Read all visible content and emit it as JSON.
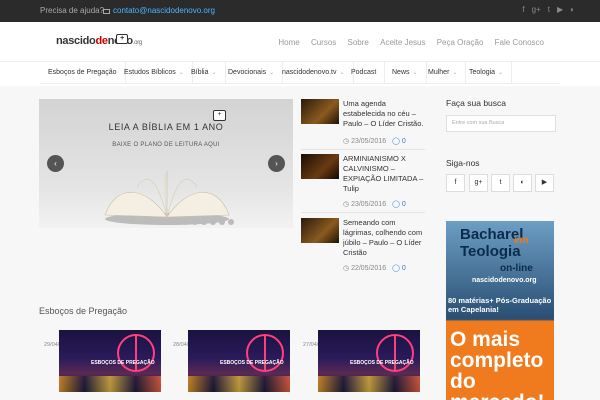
{
  "topbar": {
    "help": "Precisa de ajuda?",
    "email": "contato@nascidodenovo.org",
    "social_icons": [
      "facebook-icon",
      "google-plus-icon",
      "twitter-icon",
      "youtube-icon",
      "rss-icon"
    ]
  },
  "logo": {
    "part1": "nascido",
    "part2": "de",
    "part3": "novo",
    "tld": ".org"
  },
  "mainnav": [
    "Home",
    "Cursos",
    "Sobre",
    "Aceite Jesus",
    "Peça Oração",
    "Fale Conosco"
  ],
  "subnav": [
    {
      "label": "Esboços de Pregação",
      "has_menu": false
    },
    {
      "label": "Estudos Bíblicos",
      "has_menu": true
    },
    {
      "label": "Bíblia",
      "has_menu": true
    },
    {
      "label": "Devocionais",
      "has_menu": true
    },
    {
      "label": "nascidodenovo.tv",
      "has_menu": true
    },
    {
      "label": "Podcast",
      "has_menu": false
    },
    {
      "label": "News",
      "has_menu": true
    },
    {
      "label": "Mulher",
      "has_menu": true
    },
    {
      "label": "Teologia",
      "has_menu": true
    }
  ],
  "slider": {
    "title": "LEIA A BÍBLIA EM 1 ANO",
    "subtitle": "BAIXE O PLANO DE LEITURA AQUI",
    "prev": "‹",
    "next": "›",
    "dot_count": 7
  },
  "posts": [
    {
      "title": "Uma agenda estabelecida no céu – Paulo – O Líder Cristão.",
      "date": "23/05/2016",
      "comments": "0"
    },
    {
      "title": "ARMINIANISMO X CALVINISMO – EXPIAÇÃO LIMITADA – Tulip",
      "date": "23/05/2016",
      "comments": "0"
    },
    {
      "title": "Semeando com lágrimas, colhendo com júbilo – Paulo – O Líder Cristão",
      "date": "22/05/2016",
      "comments": "0"
    }
  ],
  "sidebar": {
    "search_title": "Faça sua busca",
    "search_placeholder": "Entre com sua Busca",
    "social_title": "Siga-nos",
    "social_buttons": [
      "f",
      "g+",
      "t",
      "rss",
      "yt"
    ]
  },
  "ad": {
    "line1": "Bacharel",
    "em": "em",
    "line2": "Teologia",
    "line3": "on-line",
    "line4": "nascidodenovo.org",
    "line5": "80 matérias+ Pós-Graduação em Capelania!",
    "line6": "O mais completo do mercado!"
  },
  "section": {
    "title": "Esboços de Pregação",
    "cards": [
      {
        "date": "29/04/2016",
        "label": "ESBOÇOS DE\nPREGAÇÃO"
      },
      {
        "date": "28/04/2016",
        "label": "ESBOÇOS DE\nPREGAÇÃO"
      },
      {
        "date": "27/04/2016",
        "label": "ESBOÇOS DE\nPREGAÇÃO"
      }
    ]
  },
  "colors": {
    "accent": "#2f7fd4",
    "topbar": "#2b2b2b",
    "ad_orange": "#f07a1e",
    "ad_blue": "#0b2b4d"
  }
}
